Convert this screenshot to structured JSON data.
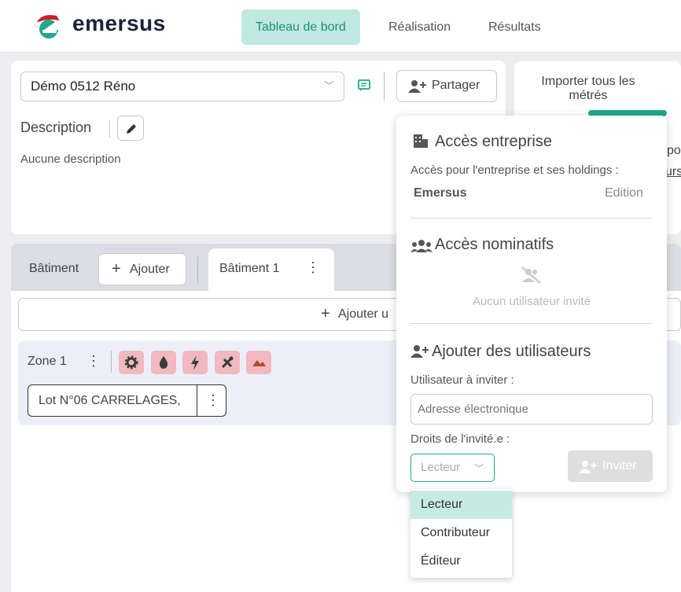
{
  "brand": {
    "name": "emersus",
    "accent": "#1fa88a"
  },
  "nav": {
    "tabs": [
      "Tableau de bord",
      "Réalisation",
      "Résultats"
    ],
    "active": 0
  },
  "project": {
    "selected": "Démo 0512 Réno",
    "description_label": "Description",
    "description_value": "Aucune description"
  },
  "toolbar": {
    "share_label": "Partager",
    "import_label": "Importer tous les métrés",
    "partial_right_1": "po",
    "partial_right_2": "urs"
  },
  "buildings": {
    "label": "Bâtiment",
    "add_label": "Ajouter",
    "tab": "Bâtiment 1",
    "add_row_label": "Ajouter u"
  },
  "zone": {
    "name": "Zone 1",
    "icons": [
      "gear-icon",
      "drop-icon",
      "bolt-icon",
      "tools-icon",
      "mountain-icon"
    ],
    "lot": "Lot N°06 CARRELAGES,"
  },
  "share_popover": {
    "company_title": "Accès entreprise",
    "company_subtitle": "Accès pour l'entreprise et ses holdings :",
    "company_name": "Emersus",
    "company_right": "Edition",
    "nominative_title": "Accès nominatifs",
    "nominative_empty": "Aucun utilisateur invité",
    "add_title": "Ajouter des utilisateurs",
    "invite_label": "Utilisateur à inviter :",
    "email_placeholder": "Adresse électronique",
    "rights_label": "Droits de l'invité.e :",
    "rights_selected": "Lecteur",
    "invite_button": "Inviter",
    "rights_options": [
      "Lecteur",
      "Contributeur",
      "Éditeur"
    ]
  }
}
